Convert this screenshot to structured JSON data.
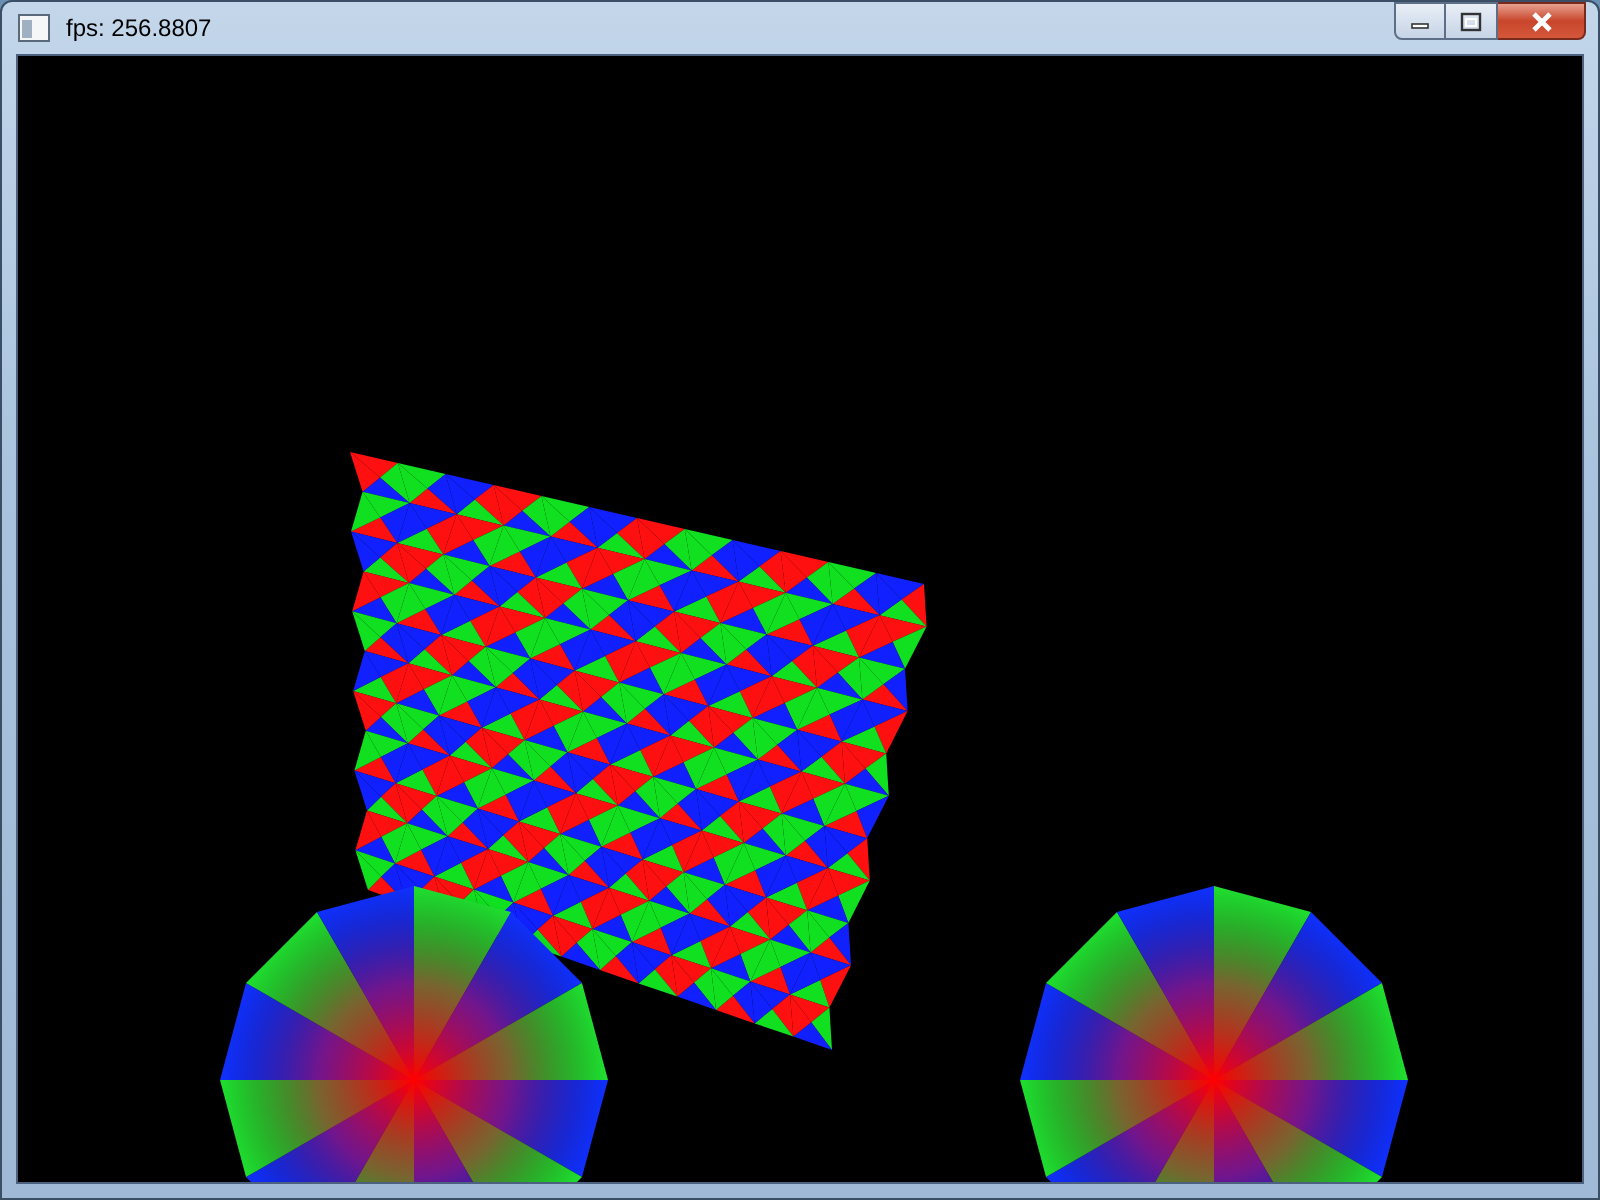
{
  "window": {
    "title": "fps: 256.8807"
  }
}
